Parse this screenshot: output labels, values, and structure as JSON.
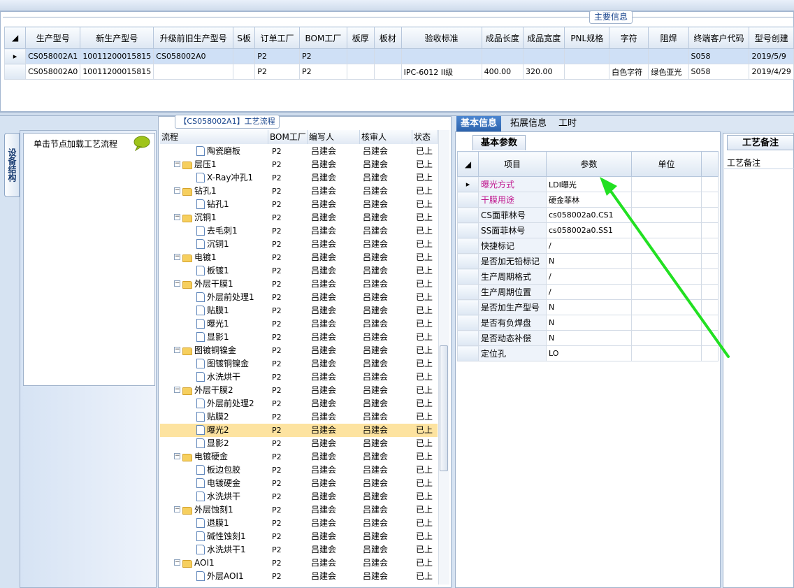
{
  "main_info_title": "主要信息",
  "main_grid": {
    "headers": [
      "生产型号",
      "新生产型号",
      "升级前旧生产型号",
      "S板",
      "订单工厂",
      "BOM工厂",
      "板厚",
      "板材",
      "验收标准",
      "成品长度",
      "成品宽度",
      "PNL规格",
      "字符",
      "阻焊",
      "终端客户代码",
      "型号创建"
    ],
    "rows": [
      [
        "CS058002A1",
        "10011200015815",
        "CS058002A0",
        "",
        "P2",
        "P2",
        "",
        "",
        "",
        "",
        "",
        "",
        "",
        "",
        "S058",
        "2019/5/9"
      ],
      [
        "CS058002A0",
        "10011200015815",
        "",
        "",
        "P2",
        "P2",
        "",
        "",
        "IPC-6012 II级",
        "400.00",
        "320.00",
        "",
        "白色字符",
        "绿色亚光",
        "S058",
        "2019/4/29"
      ]
    ]
  },
  "side_tab": "设备结构",
  "hint_text": "单击节点加载工艺流程",
  "flow_title": "【CS058002A1】工艺流程",
  "flow_headers": [
    "流程",
    "BOM工厂",
    "编写人",
    "核审人",
    "状态"
  ],
  "flow_rows": [
    {
      "name": "陶瓷磨板",
      "bom": "P2",
      "writer": "吕建会",
      "reviewer": "吕建会",
      "status": "已上"
    },
    {
      "name": "层压1",
      "bom": "P2",
      "writer": "吕建会",
      "reviewer": "吕建会",
      "status": "已上"
    },
    {
      "name": "X-Ray冲孔1",
      "bom": "P2",
      "writer": "吕建会",
      "reviewer": "吕建会",
      "status": "已上"
    },
    {
      "name": "钻孔1",
      "bom": "P2",
      "writer": "吕建会",
      "reviewer": "吕建会",
      "status": "已上"
    },
    {
      "name": "钻孔1",
      "bom": "P2",
      "writer": "吕建会",
      "reviewer": "吕建会",
      "status": "已上"
    },
    {
      "name": "沉铜1",
      "bom": "P2",
      "writer": "吕建会",
      "reviewer": "吕建会",
      "status": "已上"
    },
    {
      "name": "去毛刺1",
      "bom": "P2",
      "writer": "吕建会",
      "reviewer": "吕建会",
      "status": "已上"
    },
    {
      "name": "沉铜1",
      "bom": "P2",
      "writer": "吕建会",
      "reviewer": "吕建会",
      "status": "已上"
    },
    {
      "name": "电镀1",
      "bom": "P2",
      "writer": "吕建会",
      "reviewer": "吕建会",
      "status": "已上"
    },
    {
      "name": "板镀1",
      "bom": "P2",
      "writer": "吕建会",
      "reviewer": "吕建会",
      "status": "已上"
    },
    {
      "name": "外层干膜1",
      "bom": "P2",
      "writer": "吕建会",
      "reviewer": "吕建会",
      "status": "已上"
    },
    {
      "name": "外层前处理1",
      "bom": "P2",
      "writer": "吕建会",
      "reviewer": "吕建会",
      "status": "已上"
    },
    {
      "name": "贴膜1",
      "bom": "P2",
      "writer": "吕建会",
      "reviewer": "吕建会",
      "status": "已上"
    },
    {
      "name": "曝光1",
      "bom": "P2",
      "writer": "吕建会",
      "reviewer": "吕建会",
      "status": "已上"
    },
    {
      "name": "显影1",
      "bom": "P2",
      "writer": "吕建会",
      "reviewer": "吕建会",
      "status": "已上"
    },
    {
      "name": "图镀铜镍金",
      "bom": "P2",
      "writer": "吕建会",
      "reviewer": "吕建会",
      "status": "已上"
    },
    {
      "name": "图镀铜镍金",
      "bom": "P2",
      "writer": "吕建会",
      "reviewer": "吕建会",
      "status": "已上"
    },
    {
      "name": "水洗烘干",
      "bom": "P2",
      "writer": "吕建会",
      "reviewer": "吕建会",
      "status": "已上"
    },
    {
      "name": "外层干膜2",
      "bom": "P2",
      "writer": "吕建会",
      "reviewer": "吕建会",
      "status": "已上"
    },
    {
      "name": "外层前处理2",
      "bom": "P2",
      "writer": "吕建会",
      "reviewer": "吕建会",
      "status": "已上"
    },
    {
      "name": "贴膜2",
      "bom": "P2",
      "writer": "吕建会",
      "reviewer": "吕建会",
      "status": "已上"
    },
    {
      "name": "曝光2",
      "bom": "P2",
      "writer": "吕建会",
      "reviewer": "吕建会",
      "status": "已上"
    },
    {
      "name": "显影2",
      "bom": "P2",
      "writer": "吕建会",
      "reviewer": "吕建会",
      "status": "已上"
    },
    {
      "name": "电镀硬金",
      "bom": "P2",
      "writer": "吕建会",
      "reviewer": "吕建会",
      "status": "已上"
    },
    {
      "name": "板边包胶",
      "bom": "P2",
      "writer": "吕建会",
      "reviewer": "吕建会",
      "status": "已上"
    },
    {
      "name": "电镀硬金",
      "bom": "P2",
      "writer": "吕建会",
      "reviewer": "吕建会",
      "status": "已上"
    },
    {
      "name": "水洗烘干",
      "bom": "P2",
      "writer": "吕建会",
      "reviewer": "吕建会",
      "status": "已上"
    },
    {
      "name": "外层蚀刻1",
      "bom": "P2",
      "writer": "吕建会",
      "reviewer": "吕建会",
      "status": "已上"
    },
    {
      "name": "退膜1",
      "bom": "P2",
      "writer": "吕建会",
      "reviewer": "吕建会",
      "status": "已上"
    },
    {
      "name": "碱性蚀刻1",
      "bom": "P2",
      "writer": "吕建会",
      "reviewer": "吕建会",
      "status": "已上"
    },
    {
      "name": "水洗烘干1",
      "bom": "P2",
      "writer": "吕建会",
      "reviewer": "吕建会",
      "status": "已上"
    },
    {
      "name": "AOI1",
      "bom": "P2",
      "writer": "吕建会",
      "reviewer": "吕建会",
      "status": "已上"
    },
    {
      "name": "外层AOI1",
      "bom": "P2",
      "writer": "吕建会",
      "reviewer": "吕建会",
      "status": "已上"
    }
  ],
  "tabs": [
    "基本信息",
    "拓展信息",
    "工时"
  ],
  "basic_sub_tab": "基本参数",
  "param_headers": [
    "项目",
    "参数",
    "单位"
  ],
  "params": [
    {
      "item": "曝光方式",
      "value": "LDI曝光",
      "unit": ""
    },
    {
      "item": "干膜用途",
      "value": "硬金菲林",
      "unit": ""
    },
    {
      "item": "CS面菲林号",
      "value": "cs058002a0.CS1",
      "unit": ""
    },
    {
      "item": "SS面菲林号",
      "value": "cs058002a0.SS1",
      "unit": ""
    },
    {
      "item": "快捷标记",
      "value": "/",
      "unit": ""
    },
    {
      "item": "是否加无铅标记",
      "value": "N",
      "unit": ""
    },
    {
      "item": "生产周期格式",
      "value": "/",
      "unit": ""
    },
    {
      "item": "生产周期位置",
      "value": "/",
      "unit": ""
    },
    {
      "item": "是否加生产型号",
      "value": "N",
      "unit": ""
    },
    {
      "item": "是否有负焊盘",
      "value": "N",
      "unit": ""
    },
    {
      "item": "是否动态补偿",
      "value": "N",
      "unit": ""
    },
    {
      "item": "定位孔",
      "value": "LO",
      "unit": ""
    }
  ],
  "remark_tab": "工艺备注",
  "remark_label": "工艺备注",
  "colors": {
    "arrow": "#22e022",
    "selected_row": "#fde3a0",
    "active_tab": "#2c63ad",
    "pink_label": "#c0188f"
  }
}
